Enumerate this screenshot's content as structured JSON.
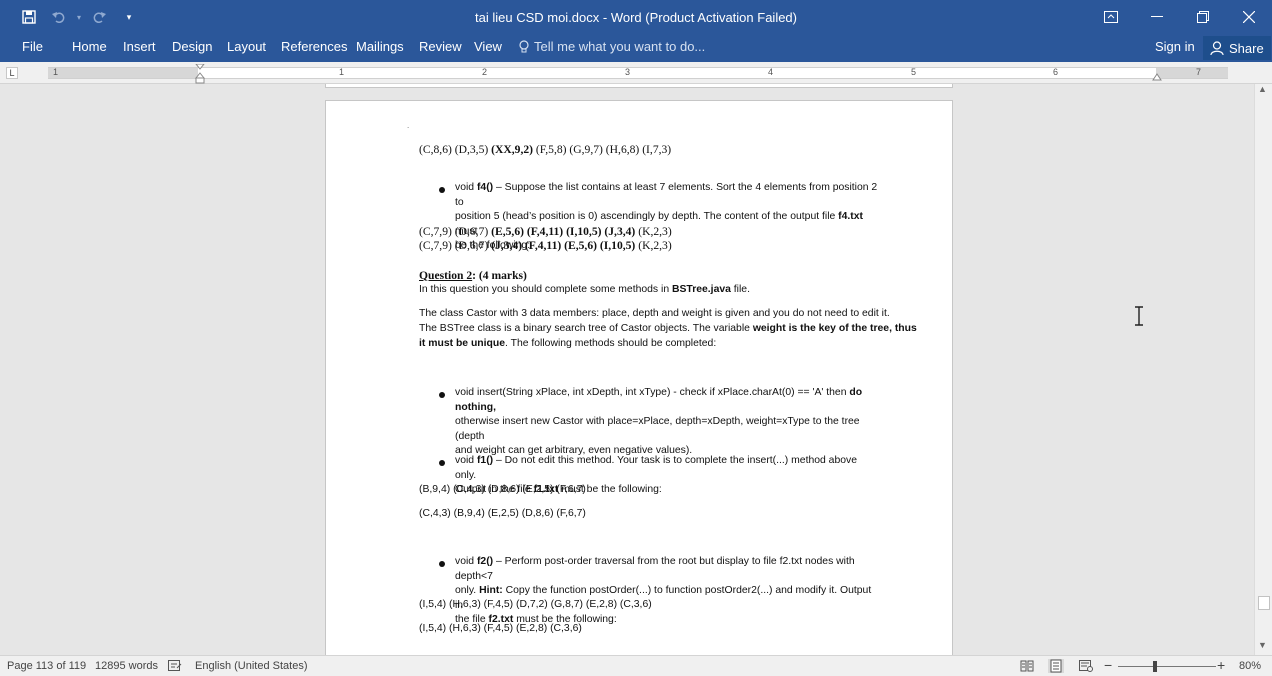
{
  "window": {
    "title": "tai lieu CSD moi.docx - Word (Product Activation Failed)"
  },
  "ribbon": {
    "file": "File",
    "tabs": [
      "Home",
      "Insert",
      "Design",
      "Layout",
      "References",
      "Mailings",
      "Review",
      "View"
    ],
    "tell_me": "Tell me what you want to do...",
    "sign_in": "Sign in",
    "share": "Share"
  },
  "ruler": {
    "numbers": [
      "1",
      "1",
      "2",
      "3",
      "4",
      "5",
      "6",
      "7"
    ]
  },
  "document": {
    "dot": ".",
    "line1": {
      "a": "(C,8,6) (D,3,5) ",
      "b": "(XX,9,2)",
      "c": " (F,5,8) (G,9,7) (H,6,8) (I,7,3)"
    },
    "f4": {
      "pre": "void ",
      "name": "f4()",
      "text1": " – Suppose the list contains at least 7 elements. Sort the 4 elements from position 2 to",
      "text2": "position 5 (head’s position is 0) ascendingly by depth. The content of the output file ",
      "file": "f4.txt",
      "text2b": " must",
      "text3": "be the following:"
    },
    "out_f4_1": {
      "a": "(C,7,9) (D,6,7) ",
      "b": "(E,5,6) (F,4,11) (I,10,5) (J,3,4)",
      "c": " (K,2,3)"
    },
    "out_f4_2": {
      "a": "(C,7,9) (D,6,7) ",
      "b": "(J,3,4) (F,4,11) (E,5,6) (I,10,5)",
      "c": " (K,2,3)"
    },
    "question2": {
      "label": "Question 2",
      "marks": ": (4 marks)",
      "intro_a": "In this question you should complete some methods in ",
      "intro_file": "BSTree.java",
      "intro_b": " file."
    },
    "para_castor": {
      "l1": "The class Castor with 3 data members: place, depth and weight is given and you do not need to edit it.",
      "l2a": "The BSTree class is a binary search tree of  Castor objects. The variable ",
      "l2b": "weight is the key of the tree, thus",
      "l3a": "it must be unique",
      "l3b": ". The following methods should be completed:"
    },
    "insert": {
      "l1a": "void insert(String xPlace, int xDepth, int xType) - check if xPlace.charAt(0) == 'A'  then ",
      "l1b": "do nothing,",
      "l2": "otherwise insert new Castor with place=xPlace, depth=xDepth, weight=xType to the tree (depth",
      "l3": "and weight can get arbitrary, even negative values)."
    },
    "f1": {
      "pre": "void ",
      "name": "f1()",
      "text1": " – Do not edit this method. Your task is to complete the insert(...) method above only.",
      "text2a": "Output in the file ",
      "file": "f1.txt",
      "text2b": " must be the following:"
    },
    "out_f1_1": "(B,9,4) (C,4,3) (D,8,6) (E,2,5) (F,6,7)",
    "out_f1_2": "(C,4,3) (B,9,4) (E,2,5) (D,8,6) (F,6,7)",
    "f2": {
      "pre": "void ",
      "name": "f2()",
      "text1": " – Perform post-order traversal from the root but display to file f2.txt nodes with depth<7",
      "text2a": "only. ",
      "hint": "Hint:",
      "text2b": " Copy the function postOrder(...)  to function postOrder2(...) and modify it. Output in",
      "text3a": "the file ",
      "file": "f2.txt",
      "text3b": " must be the following:"
    },
    "out_f2_1": "(I,5,4) (H,6,3) (F,4,5) (D,7,2) (G,8,7) (E,2,8) (C,3,6)",
    "out_f2_2": "(I,5,4) (H,6,3) (F,4,5) (E,2,8) (C,3,6)"
  },
  "status": {
    "page": "Page 113 of 119",
    "words": "12895 words",
    "language": "English (United States)",
    "zoom": "80%",
    "zoom_level": 0.8
  }
}
